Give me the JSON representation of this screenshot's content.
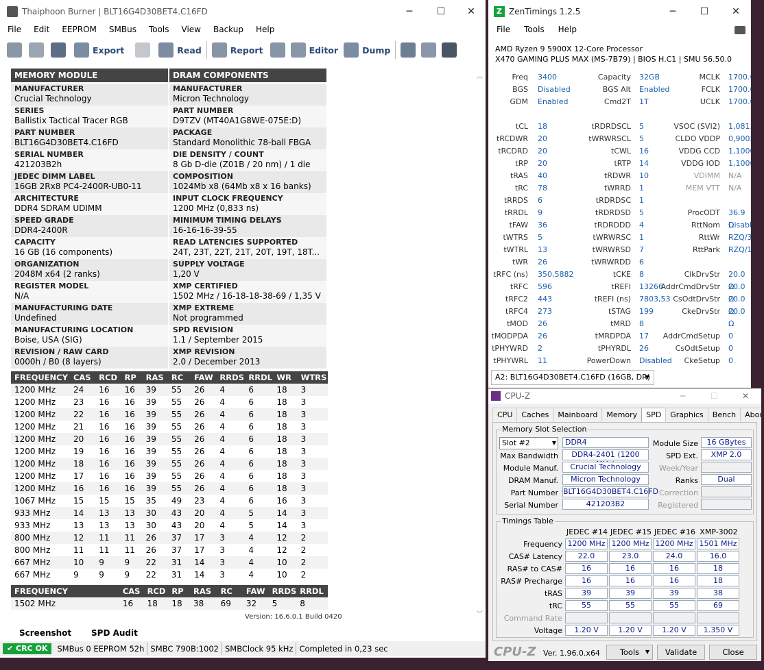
{
  "thaiphoon": {
    "title": "Thaiphoon Burner | BLT16G4D30BET4.C16FD",
    "menu": [
      "File",
      "Edit",
      "EEPROM",
      "SMBus",
      "Tools",
      "View",
      "Backup",
      "Help"
    ],
    "toolbar": {
      "export": "Export",
      "read": "Read",
      "report": "Report",
      "editor": "Editor",
      "dump": "Dump"
    },
    "left_header": "MEMORY MODULE",
    "right_header": "DRAM COMPONENTS",
    "rows": [
      {
        "l_label": "MANUFACTURER",
        "l_value": "Crucial Technology",
        "r_label": "MANUFACTURER",
        "r_value": "Micron Technology"
      },
      {
        "l_label": "SERIES",
        "l_value": "Ballistix Tactical Tracer RGB",
        "r_label": "PART NUMBER",
        "r_value": "D9TZV (MT40A1G8WE-075E:D)"
      },
      {
        "l_label": "PART NUMBER",
        "l_value": "BLT16G4D30BET4.C16FD",
        "r_label": "PACKAGE",
        "r_value": "Standard Monolithic 78-ball FBGA"
      },
      {
        "l_label": "SERIAL NUMBER",
        "l_value": "421203B2h",
        "r_label": "DIE DENSITY / COUNT",
        "r_value": "8 Gb D-die (Z01B / 20 nm) / 1 die"
      },
      {
        "l_label": "JEDEC DIMM LABEL",
        "l_value": "16GB 2Rx8 PC4-2400R-UB0-11",
        "r_label": "COMPOSITION",
        "r_value": "1024Mb x8 (64Mb x8 x 16 banks)"
      },
      {
        "l_label": "ARCHITECTURE",
        "l_value": "DDR4 SDRAM UDIMM",
        "r_label": "INPUT CLOCK FREQUENCY",
        "r_value": "1200 MHz (0,833 ns)"
      },
      {
        "l_label": "SPEED GRADE",
        "l_value": "DDR4-2400R",
        "r_label": "MINIMUM TIMING DELAYS",
        "r_value": "16-16-16-39-55"
      },
      {
        "l_label": "CAPACITY",
        "l_value": "16 GB (16 components)",
        "r_label": "READ LATENCIES SUPPORTED",
        "r_value": "24T, 23T, 22T, 21T, 20T, 19T, 18T..."
      },
      {
        "l_label": "ORGANIZATION",
        "l_value": "2048M x64 (2 ranks)",
        "r_label": "SUPPLY VOLTAGE",
        "r_value": "1,20 V"
      },
      {
        "l_label": "REGISTER MODEL",
        "l_value": "N/A",
        "r_label": "XMP CERTIFIED",
        "r_value": "1502 MHz / 16-18-18-38-69 / 1,35 V"
      },
      {
        "l_label": "MANUFACTURING DATE",
        "l_value": "Undefined",
        "r_label": "XMP EXTREME",
        "r_value": "Not programmed"
      },
      {
        "l_label": "MANUFACTURING LOCATION",
        "l_value": "Boise, USA (SIG)",
        "r_label": "SPD REVISION",
        "r_value": "1.1 / September 2015"
      },
      {
        "l_label": "REVISION / RAW CARD",
        "l_value": "0000h / B0 (8 layers)",
        "r_label": "XMP REVISION",
        "r_value": "2.0 / December 2013"
      }
    ],
    "freq_headers": [
      "FREQUENCY",
      "CAS",
      "RCD",
      "RP",
      "RAS",
      "RC",
      "FAW",
      "RRDS",
      "RRDL",
      "WR",
      "WTRS"
    ],
    "freq_rows": [
      [
        "1200 MHz",
        "24",
        "16",
        "16",
        "39",
        "55",
        "26",
        "4",
        "6",
        "18",
        "3"
      ],
      [
        "1200 MHz",
        "23",
        "16",
        "16",
        "39",
        "55",
        "26",
        "4",
        "6",
        "18",
        "3"
      ],
      [
        "1200 MHz",
        "22",
        "16",
        "16",
        "39",
        "55",
        "26",
        "4",
        "6",
        "18",
        "3"
      ],
      [
        "1200 MHz",
        "21",
        "16",
        "16",
        "39",
        "55",
        "26",
        "4",
        "6",
        "18",
        "3"
      ],
      [
        "1200 MHz",
        "20",
        "16",
        "16",
        "39",
        "55",
        "26",
        "4",
        "6",
        "18",
        "3"
      ],
      [
        "1200 MHz",
        "19",
        "16",
        "16",
        "39",
        "55",
        "26",
        "4",
        "6",
        "18",
        "3"
      ],
      [
        "1200 MHz",
        "18",
        "16",
        "16",
        "39",
        "55",
        "26",
        "4",
        "6",
        "18",
        "3"
      ],
      [
        "1200 MHz",
        "17",
        "16",
        "16",
        "39",
        "55",
        "26",
        "4",
        "6",
        "18",
        "3"
      ],
      [
        "1200 MHz",
        "16",
        "16",
        "16",
        "39",
        "55",
        "26",
        "4",
        "6",
        "18",
        "3"
      ],
      [
        "1067 MHz",
        "15",
        "15",
        "15",
        "35",
        "49",
        "23",
        "4",
        "6",
        "16",
        "3"
      ],
      [
        "933 MHz",
        "14",
        "13",
        "13",
        "30",
        "43",
        "20",
        "4",
        "5",
        "14",
        "3"
      ],
      [
        "933 MHz",
        "13",
        "13",
        "13",
        "30",
        "43",
        "20",
        "4",
        "5",
        "14",
        "3"
      ],
      [
        "800 MHz",
        "12",
        "11",
        "11",
        "26",
        "37",
        "17",
        "3",
        "4",
        "12",
        "2"
      ],
      [
        "800 MHz",
        "11",
        "11",
        "11",
        "26",
        "37",
        "17",
        "3",
        "4",
        "12",
        "2"
      ],
      [
        "667 MHz",
        "10",
        "9",
        "9",
        "22",
        "31",
        "14",
        "3",
        "4",
        "10",
        "2"
      ],
      [
        "667 MHz",
        "9",
        "9",
        "9",
        "22",
        "31",
        "14",
        "3",
        "4",
        "10",
        "2"
      ]
    ],
    "xmp_headers": [
      "FREQUENCY",
      "",
      "CAS",
      "RCD",
      "RP",
      "RAS",
      "RC",
      "FAW",
      "RRDS",
      "RRDL"
    ],
    "xmp_row": [
      "1502 MHz",
      "",
      "16",
      "18",
      "18",
      "38",
      "69",
      "32",
      "5",
      "8"
    ],
    "version": "Version: 16.6.0.1 Build 0420",
    "tabs": {
      "screenshot": "Screenshot",
      "spd_audit": "SPD Audit"
    },
    "status": {
      "crc": "CRC OK",
      "smbus": "SMBus 0 EEPROM 52h",
      "smbc": "SMBC 790B:1002",
      "clock": "SMBClock 95 kHz",
      "done": "Completed in 0,23 sec"
    }
  },
  "zen": {
    "title": "ZenTimings 1.2.5",
    "menu": [
      "File",
      "Tools",
      "Help"
    ],
    "cpu": "AMD Ryzen 9 5900X 12-Core Processor",
    "board": "X470 GAMING PLUS MAX (MS-7B79) | BIOS H.C1 | SMU 56.50.0",
    "rows": [
      [
        "Freq",
        "3400",
        "Capacity",
        "32GB",
        "MCLK",
        "1700.00"
      ],
      [
        "BGS",
        "Disabled",
        "BGS Alt",
        "Enabled",
        "FCLK",
        "1700.00"
      ],
      [
        "GDM",
        "Enabled",
        "Cmd2T",
        "1T",
        "UCLK",
        "1700.00"
      ],
      [
        "",
        "",
        "",
        "",
        "",
        ""
      ],
      [
        "tCL",
        "18",
        "tRDRDSCL",
        "5",
        "VSOC (SVI2)",
        "1,0813V"
      ],
      [
        "tRCDWR",
        "20",
        "tWRWRSCL",
        "5",
        "CLDO VDDP",
        "0,9002V"
      ],
      [
        "tRCDRD",
        "20",
        "tCWL",
        "16",
        "VDDG CCD",
        "1,1000V"
      ],
      [
        "tRP",
        "20",
        "tRTP",
        "14",
        "VDDG IOD",
        "1,1000V"
      ],
      [
        "tRAS",
        "40",
        "tRDWR",
        "10",
        "VDIMM",
        "N/A"
      ],
      [
        "tRC",
        "78",
        "tWRRD",
        "1",
        "MEM VTT",
        "N/A"
      ],
      [
        "tRRDS",
        "6",
        "tRDRDSC",
        "1",
        "",
        ""
      ],
      [
        "tRRDL",
        "9",
        "tRDRDSD",
        "5",
        "ProcODT",
        "36.9 Ω"
      ],
      [
        "tFAW",
        "36",
        "tRDRDDD",
        "4",
        "RttNom",
        "Disabled"
      ],
      [
        "tWTRS",
        "5",
        "tWRWRSC",
        "1",
        "RttWr",
        "RZQ/3"
      ],
      [
        "tWTRL",
        "13",
        "tWRWRSD",
        "7",
        "RttPark",
        "RZQ/1"
      ],
      [
        "tWR",
        "26",
        "tWRWRDD",
        "6",
        "",
        ""
      ],
      [
        "tRFC (ns)",
        "350,5882",
        "tCKE",
        "8",
        "ClkDrvStr",
        "20.0 Ω"
      ],
      [
        "tRFC",
        "596",
        "tREFI",
        "13266",
        "AddrCmdDrvStr",
        "20.0 Ω"
      ],
      [
        "tRFC2",
        "443",
        "tREFI (ns)",
        "7803,53",
        "CsOdtDrvStr",
        "20.0 Ω"
      ],
      [
        "tRFC4",
        "273",
        "tSTAG",
        "199",
        "CkeDrvStr",
        "20.0 Ω"
      ],
      [
        "tMOD",
        "26",
        "tMRD",
        "8",
        "",
        ""
      ],
      [
        "tMODPDA",
        "26",
        "tMRDPDA",
        "17",
        "AddrCmdSetup",
        "0"
      ],
      [
        "tPHYWRD",
        "2",
        "tPHYRDL",
        "26",
        "CsOdtSetup",
        "0"
      ],
      [
        "tPHYWRL",
        "11",
        "PowerDown",
        "Disabled",
        "CkeSetup",
        "0"
      ]
    ],
    "slot": "A2: BLT16G4D30BET4.C16FD (16GB, DR)"
  },
  "cpuz": {
    "title": "CPU-Z",
    "tabs": [
      "CPU",
      "Caches",
      "Mainboard",
      "Memory",
      "SPD",
      "Graphics",
      "Bench",
      "About"
    ],
    "group1": "Memory Slot Selection",
    "slot": "Slot #2",
    "type": "DDR4",
    "module_size_label": "Module Size",
    "module_size": "16 GBytes",
    "max_bw_label": "Max Bandwidth",
    "max_bw": "DDR4-2401 (1200 MHz)",
    "spd_ext_label": "SPD Ext.",
    "spd_ext": "XMP 2.0",
    "mod_manuf_label": "Module Manuf.",
    "mod_manuf": "Crucial Technology",
    "week_label": "Week/Year",
    "dram_manuf_label": "DRAM Manuf.",
    "dram_manuf": "Micron Technology",
    "ranks_label": "Ranks",
    "ranks": "Dual",
    "part_label": "Part Number",
    "part": "BLT16G4D30BET4.C16FD",
    "correction_label": "Correction",
    "serial_label": "Serial Number",
    "serial": "421203B2",
    "registered_label": "Registered",
    "group2": "Timings Table",
    "cols": [
      "JEDEC #14",
      "JEDEC #15",
      "JEDEC #16",
      "XMP-3002"
    ],
    "trows": [
      {
        "label": "Frequency",
        "vals": [
          "1200 MHz",
          "1200 MHz",
          "1200 MHz",
          "1501 MHz"
        ]
      },
      {
        "label": "CAS# Latency",
        "vals": [
          "22.0",
          "23.0",
          "24.0",
          "16.0"
        ]
      },
      {
        "label": "RAS# to CAS#",
        "vals": [
          "16",
          "16",
          "16",
          "18"
        ]
      },
      {
        "label": "RAS# Precharge",
        "vals": [
          "16",
          "16",
          "16",
          "18"
        ]
      },
      {
        "label": "tRAS",
        "vals": [
          "39",
          "39",
          "39",
          "38"
        ]
      },
      {
        "label": "tRC",
        "vals": [
          "55",
          "55",
          "55",
          "69"
        ]
      },
      {
        "label": "Command Rate",
        "vals": [
          "",
          "",
          "",
          ""
        ]
      },
      {
        "label": "Voltage",
        "vals": [
          "1.20 V",
          "1.20 V",
          "1.20 V",
          "1.350 V"
        ]
      }
    ],
    "brand": "CPU-Z",
    "version": "Ver. 1.96.0.x64",
    "tools": "Tools",
    "validate": "Validate",
    "close": "Close"
  }
}
